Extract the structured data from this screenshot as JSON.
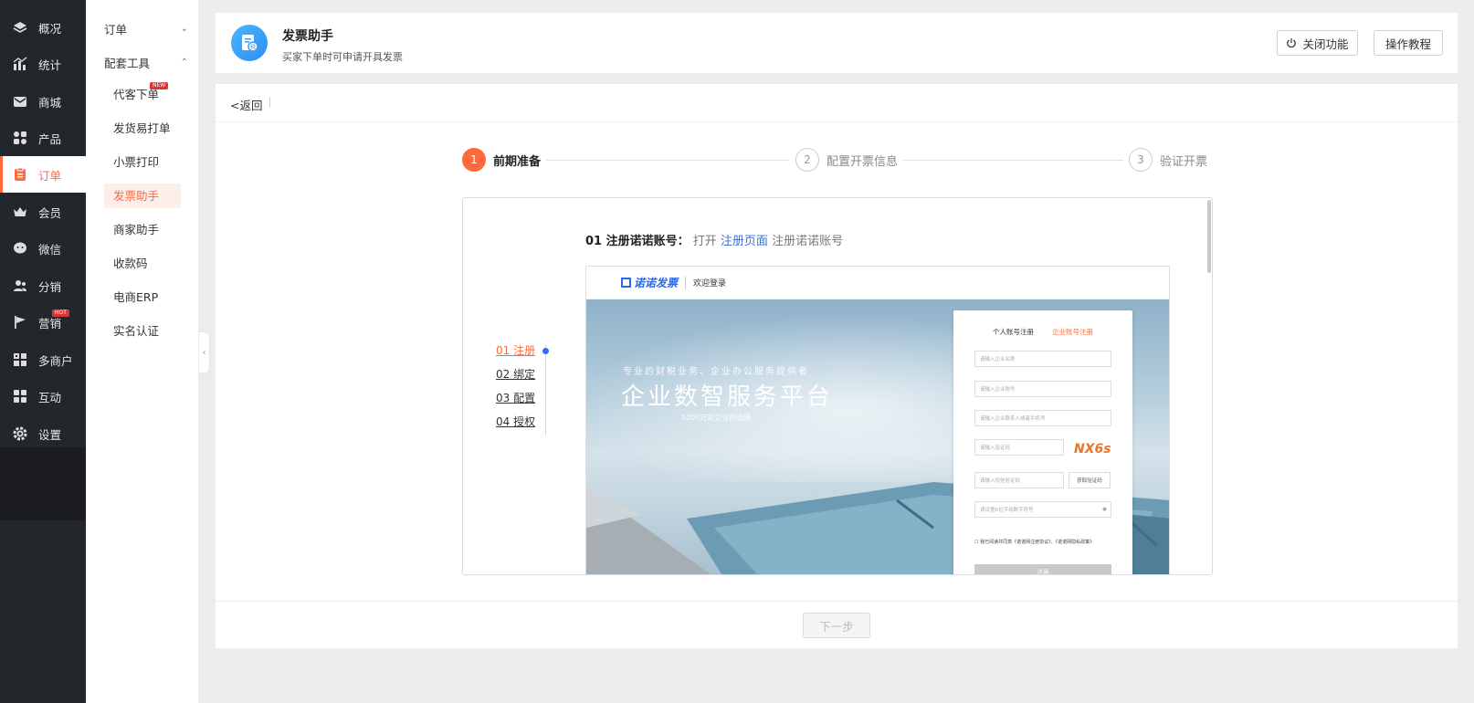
{
  "sidebar": {
    "items": [
      {
        "label": "概况",
        "icon": "layers-icon"
      },
      {
        "label": "统计",
        "icon": "chart-icon"
      },
      {
        "label": "商城",
        "icon": "mail-icon"
      },
      {
        "label": "产品",
        "icon": "grid-icon"
      },
      {
        "label": "订单",
        "icon": "clipboard-icon"
      },
      {
        "label": "会员",
        "icon": "crown-icon"
      },
      {
        "label": "微信",
        "icon": "wechat-icon"
      },
      {
        "label": "分销",
        "icon": "users-icon"
      },
      {
        "label": "营销",
        "icon": "flag-icon"
      },
      {
        "label": "多商户",
        "icon": "shop-icon"
      },
      {
        "label": "互动",
        "icon": "apps-icon"
      },
      {
        "label": "设置",
        "icon": "gear-icon"
      }
    ],
    "badges": {
      "marketing": "HOT"
    },
    "accent": "#ff6a3d"
  },
  "submenu": {
    "group_order": "订单",
    "group_tools": "配套工具",
    "items": [
      "代客下单",
      "发货易打单",
      "小票打印",
      "发票助手",
      "商家助手",
      "收款码",
      "电商ERP",
      "实名认证"
    ],
    "new_badge": "NEW"
  },
  "header": {
    "title": "发票助手",
    "subtitle": "买家下单时可申请开具发票",
    "close_btn": "关闭功能",
    "tutorial_btn": "操作教程"
  },
  "main": {
    "back": "<返回",
    "steps": [
      {
        "num": "1",
        "label": "前期准备"
      },
      {
        "num": "2",
        "label": "配置开票信息"
      },
      {
        "num": "3",
        "label": "验证开票"
      }
    ],
    "section": {
      "title": "01 注册诺诺账号：",
      "open": "打开",
      "link": "注册页面",
      "tail": "注册诺诺账号"
    },
    "anchors": [
      "01 注册",
      "02 绑定",
      "03 配置",
      "04 授权"
    ],
    "next": "下一步"
  },
  "screenshot": {
    "brand": "诺诺发票",
    "welcome": "欢迎登录",
    "hero_small": "专业的财税业务、企业办公服务提供者",
    "hero_big": "企业数智服务平台",
    "hero_tag": "1000万家企业的选择",
    "tab_personal": "个人账号注册",
    "tab_company": "企业账号注册",
    "inputs": [
      "请输入企业名称",
      "请输入企业税号",
      "请输入企业联系人或者手机号",
      "请输入验证码",
      "请输入短信验证码",
      "请设置6位字母数字符号"
    ],
    "captcha": "NX6s",
    "sms_btn": "获取验证码",
    "agree": "我已阅读并同意《诺诺网注册协议》、《诺诺网隐私政策》",
    "register": "注册"
  }
}
